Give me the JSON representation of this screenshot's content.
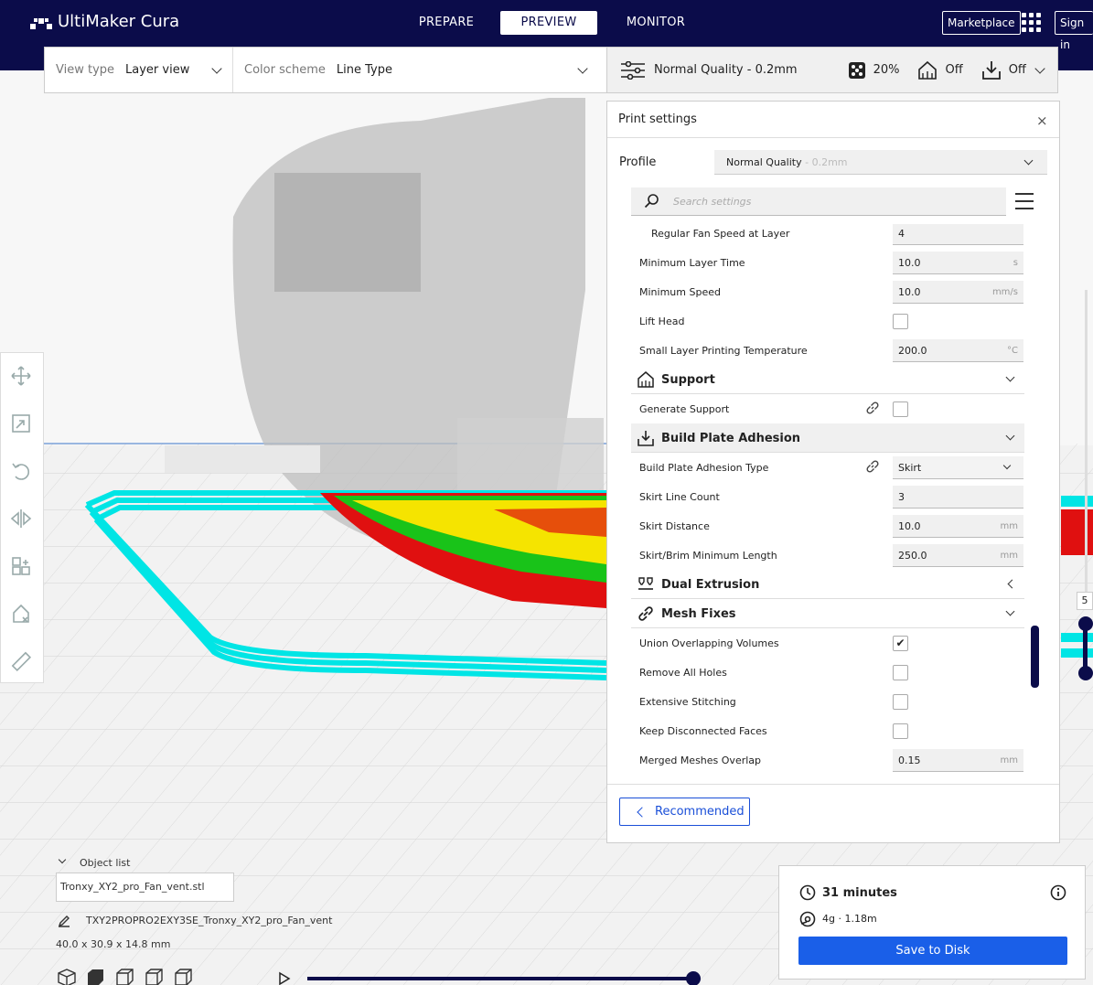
{
  "app": {
    "title": "UltiMaker Cura"
  },
  "nav": {
    "prepare": "PREPARE",
    "preview": "PREVIEW",
    "monitor": "MONITOR",
    "marketplace": "Marketplace",
    "sign_in": "Sign in"
  },
  "view": {
    "view_type_label": "View type",
    "view_type_value": "Layer view",
    "color_scheme_label": "Color scheme",
    "color_scheme_value": "Line Type"
  },
  "print_summary": {
    "quality": "Normal Quality - 0.2mm",
    "infill": "20%",
    "support": "Off",
    "adhesion": "Off"
  },
  "panel": {
    "title": "Print settings",
    "close": "×",
    "profile_label": "Profile",
    "profile_value": "Normal Quality",
    "profile_dim": " - 0.2mm",
    "search_placeholder": "Search settings",
    "settings": [
      {
        "name": "Regular Fan Speed at Layer",
        "value": "4",
        "unit": ""
      },
      {
        "name": "Minimum Layer Time",
        "value": "10.0",
        "unit": "s"
      },
      {
        "name": "Minimum Speed",
        "value": "10.0",
        "unit": "mm/s"
      },
      {
        "name": "Lift Head",
        "checked": ""
      },
      {
        "name": "Small Layer Printing Temperature",
        "value": "200.0",
        "unit": "°C"
      }
    ],
    "support": {
      "title": "Support",
      "generate_support": "Generate Support"
    },
    "adhesion": {
      "title": "Build Plate Adhesion",
      "type_label": "Build Plate Adhesion Type",
      "type_value": "Skirt",
      "skirt_line_count_label": "Skirt Line Count",
      "skirt_line_count": "3",
      "skirt_distance_label": "Skirt Distance",
      "skirt_distance": "10.0",
      "skirt_distance_unit": "mm",
      "skirt_min_length_label": "Skirt/Brim Minimum Length",
      "skirt_min_length": "250.0",
      "skirt_min_length_unit": "mm"
    },
    "dual_extrusion": {
      "title": "Dual Extrusion"
    },
    "mesh_fixes": {
      "title": "Mesh Fixes",
      "union": "Union Overlapping Volumes",
      "union_check": "✔",
      "remove_holes": "Remove All Holes",
      "extensive": "Extensive Stitching",
      "keep_faces": "Keep Disconnected Faces",
      "merged_overlap_label": "Merged Meshes Overlap",
      "merged_overlap": "0.15",
      "merged_overlap_unit": "mm"
    },
    "recommended": "Recommended"
  },
  "layer_slider": {
    "value": "5"
  },
  "objects": {
    "header": "Object list",
    "file": "Tronxy_XY2_pro_Fan_vent.stl",
    "machine": "TXY2PROPRO2EXY3SE_Tronxy_XY2_pro_Fan_vent",
    "dims": "40.0 x 30.9 x 14.8 mm"
  },
  "estimate": {
    "time": "31 minutes",
    "material": "4g · 1.18m",
    "save": "Save to Disk"
  },
  "colors": {
    "brand_dark": "#0b0c4a",
    "accent": "#1a5fe8",
    "skirt": "#00e5e5",
    "wall_red": "#e01010",
    "wall_green": "#19c319",
    "infill_yellow": "#f5e400"
  }
}
